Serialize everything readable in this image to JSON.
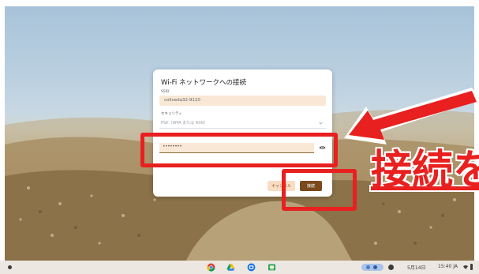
{
  "dialog": {
    "title": "Wi-Fi ネットワークへの接続",
    "ssid_label": "SSID",
    "ssid_value": "collveda32-9110",
    "security_label": "セキュリティ",
    "security_value": "PSK（WPA または RSN）",
    "password_value": "••••••••",
    "cancel_label": "キャンセル",
    "connect_label": "接続"
  },
  "annotation": {
    "text": "接続を",
    "color": "#e8201f"
  },
  "shelf": {
    "date": "5月14日",
    "status": "15:40 JA"
  },
  "icons": [
    "chrome-icon",
    "drive-icon",
    "meet-icon",
    "classroom-icon",
    "eye-icon",
    "chevron-down-icon",
    "wifi-icon",
    "battery-icon",
    "launcher-icon",
    "notification-icon"
  ]
}
